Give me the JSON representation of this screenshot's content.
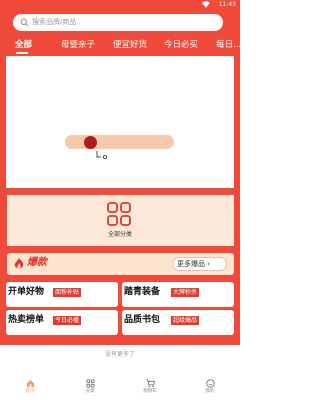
{
  "status_bar": {
    "time": "11:43"
  },
  "search": {
    "placeholder": "搜索品牌/商品"
  },
  "tabs": [
    {
      "label": "全部"
    },
    {
      "label": "母婴亲子"
    },
    {
      "label": "便宜好货"
    },
    {
      "label": "今日必买"
    },
    {
      "label": "每日..."
    }
  ],
  "category": {
    "label": "全部分类",
    "icon": "grid-icon"
  },
  "hot": {
    "title": "爆款",
    "more_label": "更多爆品 ›",
    "icon": "fire-icon"
  },
  "grid": [
    {
      "title": "开单好物",
      "tag": "面粉补贴"
    },
    {
      "title": "踏青装备",
      "tag": "大牌秒杀"
    },
    {
      "title": "热卖榜单",
      "tag": "今日必播"
    },
    {
      "title": "品质书包",
      "tag": "超级爆品"
    }
  ],
  "footer_note": "没有更多了",
  "bottom_nav": [
    {
      "label": "首页",
      "icon": "home-icon",
      "active": true
    },
    {
      "label": "分类",
      "icon": "category-icon"
    },
    {
      "label": "购物车",
      "icon": "cart-icon"
    },
    {
      "label": "我的",
      "icon": "profile-icon"
    }
  ],
  "colors": {
    "primary": "#f04a3a",
    "tag": "#e33a2c",
    "card_bg": "#fbe8d8"
  }
}
